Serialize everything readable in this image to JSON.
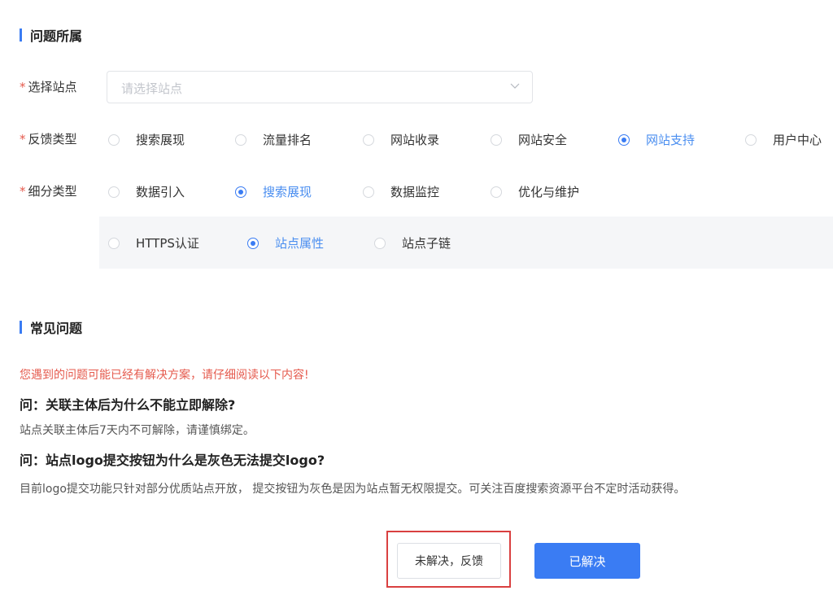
{
  "section1": {
    "title": "问题所属"
  },
  "site": {
    "label": "选择站点",
    "required_mark": "*",
    "placeholder": "请选择站点"
  },
  "feedback_type": {
    "label": "反馈类型",
    "required_mark": "*",
    "options": [
      "搜索展现",
      "流量排名",
      "网站收录",
      "网站安全",
      "网站支持",
      "用户中心"
    ],
    "selected": "网站支持"
  },
  "sub_type": {
    "label": "细分类型",
    "required_mark": "*",
    "options": [
      "数据引入",
      "搜索展现",
      "数据监控",
      "优化与维护"
    ],
    "selected": "搜索展现",
    "children": {
      "options": [
        "HTTPS认证",
        "站点属性",
        "站点子链"
      ],
      "selected": "站点属性"
    }
  },
  "section2": {
    "title": "常见问题"
  },
  "faq": {
    "notice": "您遇到的问题可能已经有解决方案，请仔细阅读以下内容!",
    "items": [
      {
        "q": "问：关联主体后为什么不能立即解除?",
        "a": "站点关联主体后7天内不可解除，请谨慎绑定。"
      },
      {
        "q": "问：站点logo提交按钮为什么是灰色无法提交logo?",
        "a": "目前logo提交功能只针对部分优质站点开放， 提交按钮为灰色是因为站点暂无权限提交。可关注百度搜索资源平台不定时活动获得。"
      }
    ]
  },
  "buttons": {
    "unresolved": "未解决，反馈",
    "resolved": "已解决"
  },
  "colors": {
    "accent": "#3a7cf3",
    "required": "#e55a4d",
    "highlight": "#d94040"
  }
}
